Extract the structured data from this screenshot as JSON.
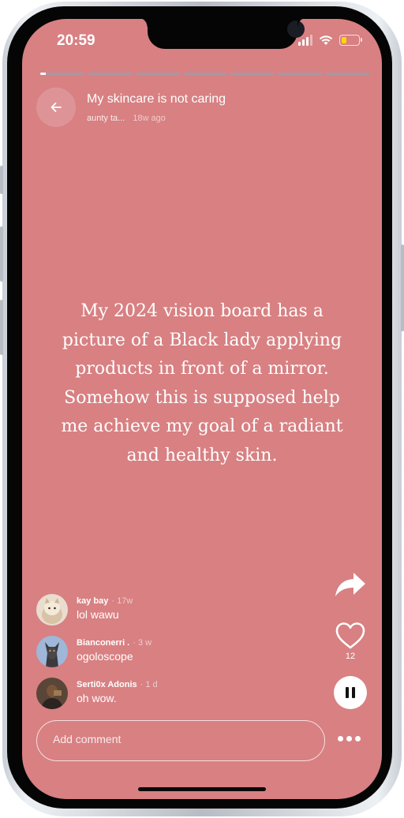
{
  "status_bar": {
    "time": "20:59",
    "battery_level": 0.3,
    "battery_color": "#ffd60a",
    "icons": [
      "signal-icon",
      "wifi-icon",
      "battery-icon"
    ]
  },
  "story": {
    "segments": 7,
    "current_segment_progress": 0.12,
    "title": "My skincare is not caring",
    "author": "aunty ta...",
    "posted_ago": "18w ago",
    "text": "My 2024 vision board has a picture of a Black lady applying products in front of a mirror. Somehow this is supposed help me achieve my goal of a radiant and healthy skin.",
    "background_color": "#d88082"
  },
  "actions": {
    "like_count": "12",
    "icons": [
      "share-icon",
      "heart-icon",
      "pause-icon",
      "more-icon"
    ]
  },
  "comments": [
    {
      "author": "kay bay",
      "ago": "· 17w",
      "text": "lol wawu"
    },
    {
      "author": "Bianconerri .",
      "ago": "· 3 w",
      "text": "ogoloscope"
    },
    {
      "author": "Serti0x Adonis",
      "ago": "· 1 d",
      "text": "oh wow."
    }
  ],
  "comment_input": {
    "placeholder": "Add comment"
  }
}
